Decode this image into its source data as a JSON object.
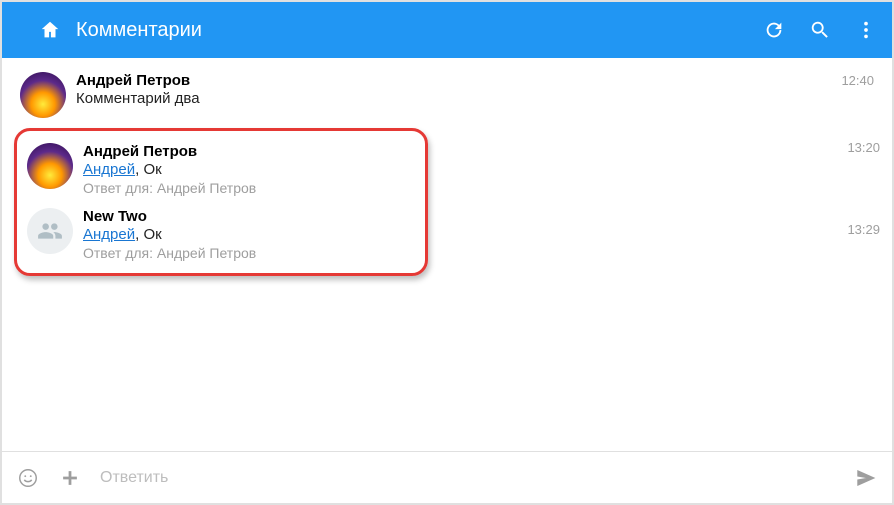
{
  "header": {
    "title": "Комментарии"
  },
  "comments": {
    "top": {
      "author": "Андрей Петров",
      "text": "Комментарий два",
      "time": "12:40"
    },
    "replies": [
      {
        "author": "Андрей Петров",
        "mention": "Андрей",
        "after_mention": ", Ок",
        "reply_to": "Ответ для: Андрей Петров",
        "time": "13:20",
        "avatar": "tree"
      },
      {
        "author": "New Two",
        "mention": "Андрей",
        "after_mention": ", Ок",
        "reply_to": "Ответ для: Андрей Петров",
        "time": "13:29",
        "avatar": "placeholder"
      }
    ]
  },
  "footer": {
    "placeholder": "Ответить"
  }
}
